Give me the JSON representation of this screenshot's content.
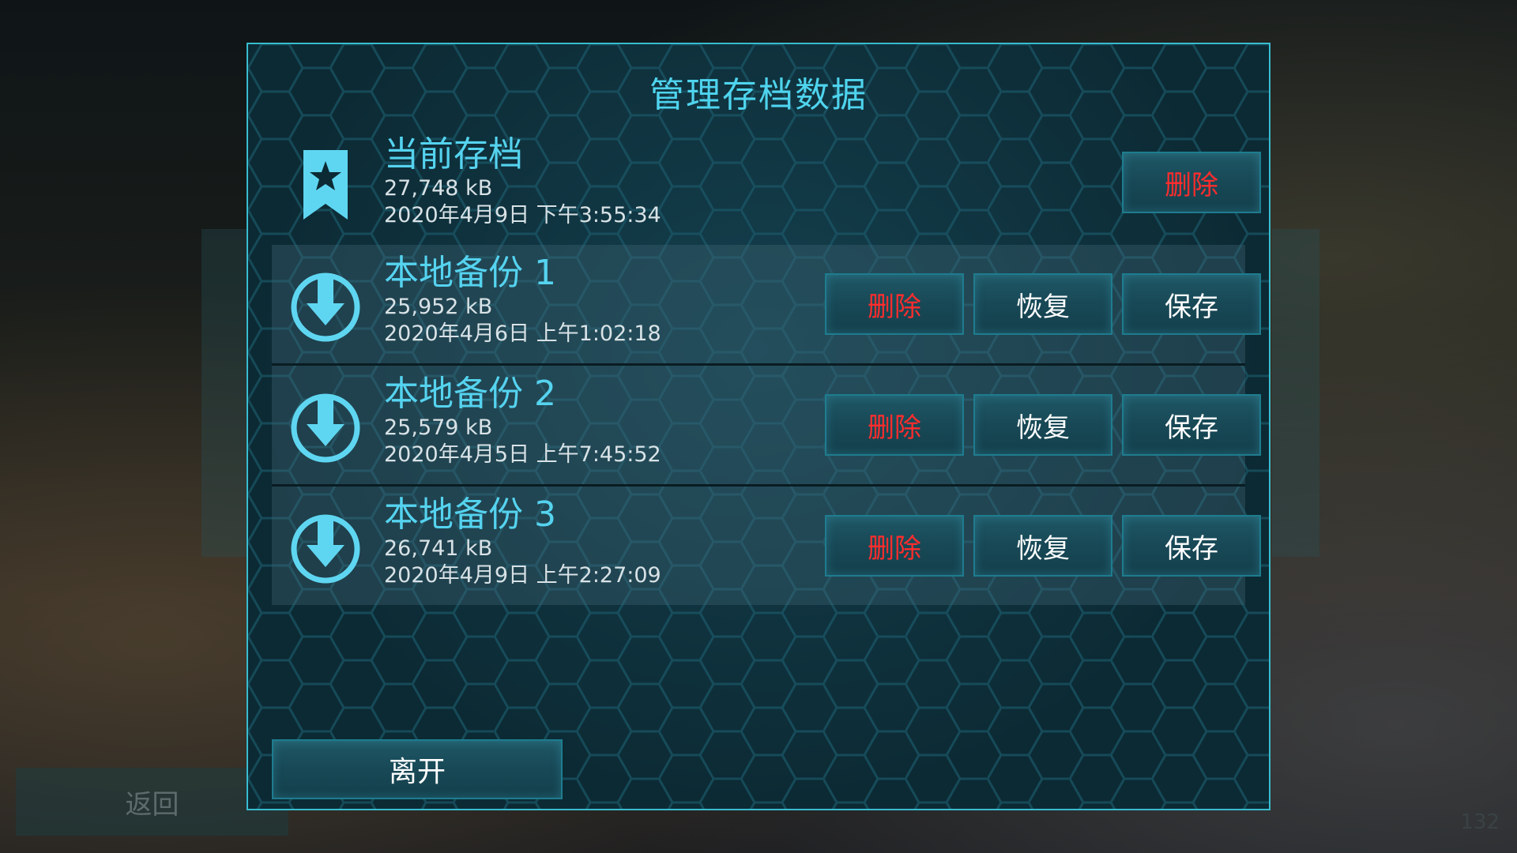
{
  "background": {
    "back_label": "返回",
    "version": "132"
  },
  "dialog": {
    "title": "管理存档数据",
    "current_save": {
      "title": "当前存档",
      "size": "27,748 kB",
      "date": "2020年4月9日 下午3:55:34",
      "delete_label": "删除",
      "icon": "bookmark-star-icon"
    },
    "backups": [
      {
        "title": "本地备份 1",
        "size": "25,952 kB",
        "date": "2020年4月6日 上午1:02:18",
        "delete_label": "删除",
        "restore_label": "恢复",
        "save_label": "保存",
        "icon": "download-circle-icon"
      },
      {
        "title": "本地备份 2",
        "size": "25,579 kB",
        "date": "2020年4月5日 上午7:45:52",
        "delete_label": "删除",
        "restore_label": "恢复",
        "save_label": "保存",
        "icon": "download-circle-icon"
      },
      {
        "title": "本地备份 3",
        "size": "26,741 kB",
        "date": "2020年4月9日 上午2:27:09",
        "delete_label": "删除",
        "restore_label": "恢复",
        "save_label": "保存",
        "icon": "download-circle-icon"
      }
    ],
    "leave_label": "离开"
  },
  "colors": {
    "accent": "#4fd4ee",
    "border": "#38bcd0",
    "danger": "#ff2d2d",
    "panel": "#0c2a34"
  }
}
